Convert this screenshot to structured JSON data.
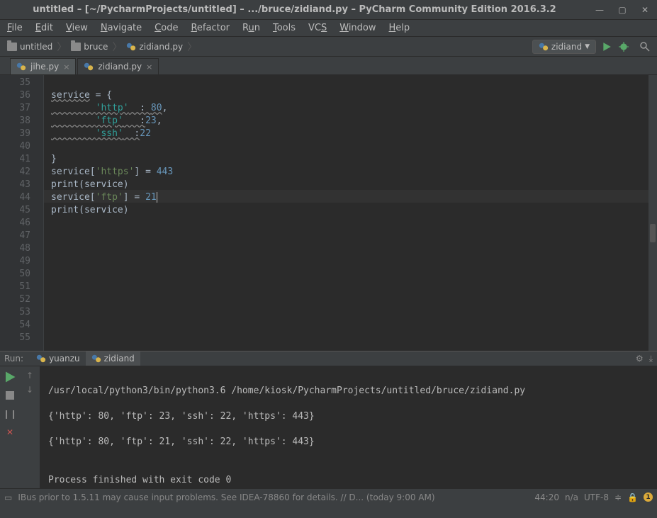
{
  "titlebar": {
    "title": "untitled – [~/PycharmProjects/untitled] – .../bruce/zidiand.py – PyCharm Community Edition 2016.3.2"
  },
  "menu": {
    "file": "File",
    "edit": "Edit",
    "view": "View",
    "navigate": "Navigate",
    "code": "Code",
    "refactor": "Refactor",
    "run": "Run",
    "tools": "Tools",
    "vcs": "VCS",
    "window": "Window",
    "help": "Help"
  },
  "breadcrumb": {
    "project": "untitled",
    "folder": "bruce",
    "file": "zidiand.py"
  },
  "run_config": {
    "selected": "zidiand"
  },
  "tabs": {
    "t0": "jihe.py",
    "t1": "zidiand.py"
  },
  "gutter": {
    "l35": "35",
    "l36": "36",
    "l37": "37",
    "l38": "38",
    "l39": "39",
    "l40": "40",
    "l41": "41",
    "l42": "42",
    "l43": "43",
    "l44": "44",
    "l45": "45",
    "l46": "46",
    "l47": "47",
    "l48": "48",
    "l49": "49",
    "l50": "50",
    "l51": "51",
    "l52": "52",
    "l53": "53",
    "l54": "54",
    "l55": "55"
  },
  "code": {
    "l36_a": "service",
    " l36_b": " = {",
    "l37_pad": "        ",
    "l37_str": "'http'",
    "l37_sep": "  : ",
    "l37_num": "80",
    "l37_comma": ",",
    "l38_pad": "        ",
    "l38_str": "'ftp'",
    "l38_sep": "   :",
    "l38_num": "23",
    "l38_comma": ",",
    "l39_pad": "        ",
    "l39_str": "'ssh'",
    "l39_sep": "  :",
    "l39_num": "22",
    "l41": "}",
    "l42_a": "service[",
    "l42_str": "'https'",
    "l42_b": "] = ",
    "l42_num": "443",
    "l43_a": "print(service)",
    "l44_a": "service[",
    "l44_str": "'ftp'",
    "l44_b": "] = ",
    "l44_num": "21",
    "l45_a": "print(service)"
  },
  "run_panel": {
    "label": "Run:",
    "tab0": "yuanzu",
    "tab1": "zidiand"
  },
  "output": {
    "l1": "/usr/local/python3/bin/python3.6 /home/kiosk/PycharmProjects/untitled/bruce/zidiand.py",
    "l2": "{'http': 80, 'ftp': 23, 'ssh': 22, 'https': 443}",
    "l3": "{'http': 80, 'ftp': 21, 'ssh': 22, 'https': 443}",
    "l4": "",
    "l5": "Process finished with exit code 0"
  },
  "status": {
    "msg": "IBus prior to 1.5.11 may cause input problems. See IDEA-78860 for details. // D... (today 9:00 AM)",
    "pos": "44:20",
    "na": "n/a",
    "enc": "UTF-8",
    "lock": "🔒",
    "notif": "1"
  }
}
